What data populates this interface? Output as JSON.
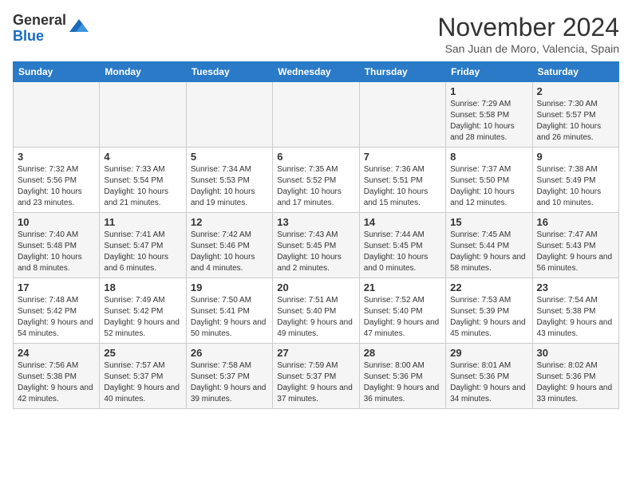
{
  "logo": {
    "general": "General",
    "blue": "Blue"
  },
  "header": {
    "month": "November 2024",
    "location": "San Juan de Moro, Valencia, Spain"
  },
  "weekdays": [
    "Sunday",
    "Monday",
    "Tuesday",
    "Wednesday",
    "Thursday",
    "Friday",
    "Saturday"
  ],
  "weeks": [
    [
      {
        "day": "",
        "info": ""
      },
      {
        "day": "",
        "info": ""
      },
      {
        "day": "",
        "info": ""
      },
      {
        "day": "",
        "info": ""
      },
      {
        "day": "",
        "info": ""
      },
      {
        "day": "1",
        "info": "Sunrise: 7:29 AM\nSunset: 5:58 PM\nDaylight: 10 hours and 28 minutes."
      },
      {
        "day": "2",
        "info": "Sunrise: 7:30 AM\nSunset: 5:57 PM\nDaylight: 10 hours and 26 minutes."
      }
    ],
    [
      {
        "day": "3",
        "info": "Sunrise: 7:32 AM\nSunset: 5:56 PM\nDaylight: 10 hours and 23 minutes."
      },
      {
        "day": "4",
        "info": "Sunrise: 7:33 AM\nSunset: 5:54 PM\nDaylight: 10 hours and 21 minutes."
      },
      {
        "day": "5",
        "info": "Sunrise: 7:34 AM\nSunset: 5:53 PM\nDaylight: 10 hours and 19 minutes."
      },
      {
        "day": "6",
        "info": "Sunrise: 7:35 AM\nSunset: 5:52 PM\nDaylight: 10 hours and 17 minutes."
      },
      {
        "day": "7",
        "info": "Sunrise: 7:36 AM\nSunset: 5:51 PM\nDaylight: 10 hours and 15 minutes."
      },
      {
        "day": "8",
        "info": "Sunrise: 7:37 AM\nSunset: 5:50 PM\nDaylight: 10 hours and 12 minutes."
      },
      {
        "day": "9",
        "info": "Sunrise: 7:38 AM\nSunset: 5:49 PM\nDaylight: 10 hours and 10 minutes."
      }
    ],
    [
      {
        "day": "10",
        "info": "Sunrise: 7:40 AM\nSunset: 5:48 PM\nDaylight: 10 hours and 8 minutes."
      },
      {
        "day": "11",
        "info": "Sunrise: 7:41 AM\nSunset: 5:47 PM\nDaylight: 10 hours and 6 minutes."
      },
      {
        "day": "12",
        "info": "Sunrise: 7:42 AM\nSunset: 5:46 PM\nDaylight: 10 hours and 4 minutes."
      },
      {
        "day": "13",
        "info": "Sunrise: 7:43 AM\nSunset: 5:45 PM\nDaylight: 10 hours and 2 minutes."
      },
      {
        "day": "14",
        "info": "Sunrise: 7:44 AM\nSunset: 5:45 PM\nDaylight: 10 hours and 0 minutes."
      },
      {
        "day": "15",
        "info": "Sunrise: 7:45 AM\nSunset: 5:44 PM\nDaylight: 9 hours and 58 minutes."
      },
      {
        "day": "16",
        "info": "Sunrise: 7:47 AM\nSunset: 5:43 PM\nDaylight: 9 hours and 56 minutes."
      }
    ],
    [
      {
        "day": "17",
        "info": "Sunrise: 7:48 AM\nSunset: 5:42 PM\nDaylight: 9 hours and 54 minutes."
      },
      {
        "day": "18",
        "info": "Sunrise: 7:49 AM\nSunset: 5:42 PM\nDaylight: 9 hours and 52 minutes."
      },
      {
        "day": "19",
        "info": "Sunrise: 7:50 AM\nSunset: 5:41 PM\nDaylight: 9 hours and 50 minutes."
      },
      {
        "day": "20",
        "info": "Sunrise: 7:51 AM\nSunset: 5:40 PM\nDaylight: 9 hours and 49 minutes."
      },
      {
        "day": "21",
        "info": "Sunrise: 7:52 AM\nSunset: 5:40 PM\nDaylight: 9 hours and 47 minutes."
      },
      {
        "day": "22",
        "info": "Sunrise: 7:53 AM\nSunset: 5:39 PM\nDaylight: 9 hours and 45 minutes."
      },
      {
        "day": "23",
        "info": "Sunrise: 7:54 AM\nSunset: 5:38 PM\nDaylight: 9 hours and 43 minutes."
      }
    ],
    [
      {
        "day": "24",
        "info": "Sunrise: 7:56 AM\nSunset: 5:38 PM\nDaylight: 9 hours and 42 minutes."
      },
      {
        "day": "25",
        "info": "Sunrise: 7:57 AM\nSunset: 5:37 PM\nDaylight: 9 hours and 40 minutes."
      },
      {
        "day": "26",
        "info": "Sunrise: 7:58 AM\nSunset: 5:37 PM\nDaylight: 9 hours and 39 minutes."
      },
      {
        "day": "27",
        "info": "Sunrise: 7:59 AM\nSunset: 5:37 PM\nDaylight: 9 hours and 37 minutes."
      },
      {
        "day": "28",
        "info": "Sunrise: 8:00 AM\nSunset: 5:36 PM\nDaylight: 9 hours and 36 minutes."
      },
      {
        "day": "29",
        "info": "Sunrise: 8:01 AM\nSunset: 5:36 PM\nDaylight: 9 hours and 34 minutes."
      },
      {
        "day": "30",
        "info": "Sunrise: 8:02 AM\nSunset: 5:36 PM\nDaylight: 9 hours and 33 minutes."
      }
    ]
  ]
}
